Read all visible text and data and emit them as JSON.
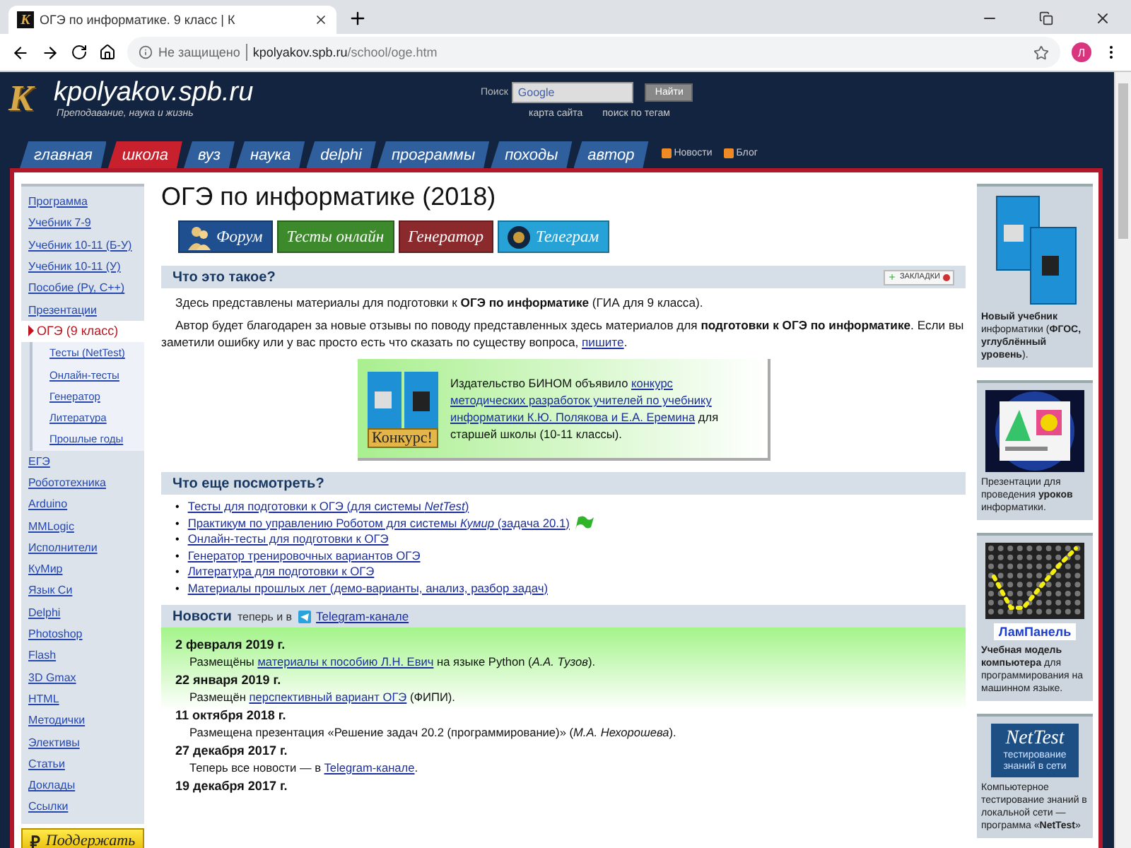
{
  "browser": {
    "favicon_letter": "K",
    "tab_title": "ОГЭ по информатике. 9 класс | К",
    "security": "Не защищено",
    "host": "kpolyakov.spb.ru",
    "path": "/school/oge.htm",
    "profile_initial": "Л"
  },
  "site": {
    "logo_letter": "K",
    "title": "kpolyakov.spb.ru",
    "slogan": "Преподавание, наука и жизнь",
    "search": {
      "label": "Поиск",
      "placeholder": "Google",
      "button": "Найти"
    },
    "links": [
      "карта сайта",
      "поиск по тегам"
    ],
    "nav_tabs": [
      {
        "label": "главная",
        "selected": false
      },
      {
        "label": "школа",
        "selected": true
      },
      {
        "label": "вуз",
        "selected": false
      },
      {
        "label": "наука",
        "selected": false
      },
      {
        "label": "delphi",
        "selected": false
      },
      {
        "label": "программы",
        "selected": false
      },
      {
        "label": "походы",
        "selected": false
      },
      {
        "label": "автор",
        "selected": false
      }
    ],
    "feeds": [
      "Новости",
      "Блог"
    ]
  },
  "sidebar": {
    "items": [
      {
        "label": "Программа",
        "selected": false
      },
      {
        "label": "Учебник 7-9",
        "selected": false
      },
      {
        "label": "Учебник 10-11 (Б-У)",
        "selected": false
      },
      {
        "label": "Учебник 10-11 (У)",
        "selected": false
      },
      {
        "label": "Пособие (Py, C++)",
        "selected": false
      },
      {
        "label": "Презентации",
        "selected": false
      },
      {
        "label": "ОГЭ (9 класс)",
        "selected": true,
        "children": [
          {
            "label": "Тесты (NetTest)",
            "selected": false
          },
          {
            "label": "Онлайн-тесты",
            "selected": false
          },
          {
            "label": "Генератор",
            "selected": false
          },
          {
            "label": "Литература",
            "selected": false
          },
          {
            "label": "Прошлые годы",
            "selected": false
          }
        ]
      },
      {
        "label": "ЕГЭ",
        "selected": false
      },
      {
        "label": "Робототехника",
        "selected": false
      },
      {
        "label": "Arduino",
        "selected": false
      },
      {
        "label": "MMLogic",
        "selected": false
      },
      {
        "label": "Исполнители",
        "selected": false
      },
      {
        "label": "КуМир",
        "selected": false
      },
      {
        "label": "Язык Си",
        "selected": false
      },
      {
        "label": "Delphi",
        "selected": false
      },
      {
        "label": "Photoshop",
        "selected": false
      },
      {
        "label": "Flash",
        "selected": false
      },
      {
        "label": "3D Gmax",
        "selected": false
      },
      {
        "label": "HTML",
        "selected": false
      },
      {
        "label": "Методички",
        "selected": false
      },
      {
        "label": "Элективы",
        "selected": false
      },
      {
        "label": "Статьи",
        "selected": false
      },
      {
        "label": "Доклады",
        "selected": false
      },
      {
        "label": "Ссылки",
        "selected": false
      }
    ],
    "donate": {
      "symbol": "₽",
      "label": "Поддержать"
    }
  },
  "main": {
    "title": "ОГЭ по информатике (2018)",
    "buttons": [
      {
        "label": "Форум",
        "kind": "people",
        "color": "#1f4f8e"
      },
      {
        "label": "Тесты онлайн",
        "kind": "plain",
        "color": "#3d8a2c"
      },
      {
        "label": "Генератор",
        "kind": "plain",
        "color": "#8a2a2c"
      },
      {
        "label": "Телеграм",
        "kind": "logo",
        "color": "#27a2d6"
      }
    ],
    "about": {
      "heading": "Что это такое?",
      "bookmarks": "ЗАКЛАДКИ",
      "paragraphs": [
        [
          {
            "kind": "text",
            "text": "Здесь представлены материалы для подготовки к **ОГЭ по информатике** (ГИА для 9 класса)."
          }
        ],
        [
          {
            "kind": "text",
            "text": "Автор будет благодарен за новые отзывы по поводу представленных здесь материалов для **подготовки к ОГЭ по информатике**. Если вы заметили ошибку или у вас просто есть что сказать по существу вопроса, "
          },
          {
            "kind": "link",
            "text": "пишите"
          },
          {
            "kind": "text",
            "text": "."
          }
        ]
      ],
      "promo": {
        "image_label": "Конкурс!",
        "lines": [
          [
            {
              "kind": "text",
              "text": "Издательство БИНОМ объявило "
            },
            {
              "kind": "link",
              "text": "конкурс"
            }
          ],
          [
            {
              "kind": "link",
              "text": "методических разработок учителей по учебнику"
            }
          ],
          [
            {
              "kind": "link",
              "text": "информатики К.Ю. Полякова и Е.А. Еремина"
            },
            {
              "kind": "text",
              "text": " для"
            }
          ],
          [
            {
              "kind": "text",
              "text": "старшей школы (10-11 классы)."
            }
          ]
        ]
      }
    },
    "more": {
      "heading": "Что еще посмотреть?",
      "bullet": "•",
      "items": [
        {
          "text": "Тесты для подготовки к ОГЭ (для системы *NetTest*)",
          "flagged": false
        },
        {
          "text": "Практикум по управлению Роботом для системы *Кумир* (задача 20.1)",
          "flagged": true
        },
        {
          "text": "Онлайн-тесты для подготовки к ОГЭ",
          "flagged": false
        },
        {
          "text": "Генератор тренировочных вариантов ОГЭ",
          "flagged": false
        },
        {
          "text": "Литература для подготовки к ОГЭ",
          "flagged": false
        },
        {
          "text": "Материалы прошлых лет (демо-варианты, анализ, разбор задач)",
          "flagged": false
        }
      ]
    },
    "news": {
      "heading": "Новости",
      "note": "теперь и в",
      "link": "Telegram-канале",
      "items": [
        {
          "date": "2 февраля 2019 г.",
          "parts": [
            {
              "kind": "text",
              "text": "Размещёны "
            },
            {
              "kind": "link",
              "text": "материалы к пособию Л.Н. Евич"
            },
            {
              "kind": "text",
              "text": " на языке Python (*А.А. Тузов*)."
            }
          ]
        },
        {
          "date": "22 января 2019 г.",
          "parts": [
            {
              "kind": "text",
              "text": "Размещён "
            },
            {
              "kind": "link",
              "text": "перспективный вариант ОГЭ"
            },
            {
              "kind": "text",
              "text": " (ФИПИ)."
            }
          ]
        },
        {
          "date": "11 октября 2018 г.",
          "parts": [
            {
              "kind": "text",
              "text": "Размещена презентация «Решение задач 20.2 (программирование)» (*М.А. Нехорошева*)."
            }
          ]
        },
        {
          "date": "27 декабря 2017 г.",
          "parts": [
            {
              "kind": "text",
              "text": "Теперь все новости — в "
            },
            {
              "kind": "link",
              "text": "Telegram-канале"
            },
            {
              "kind": "text",
              "text": "."
            }
          ]
        },
        {
          "date": "19 декабря 2017 г."
        }
      ]
    }
  },
  "aside": {
    "cards": [
      {
        "kind": "books",
        "caption": "**Новый учебник** информатики (**ФГОС, углублённый уровень**)."
      },
      {
        "kind": "picture",
        "caption": "Презентации для проведения **уроков** информатики."
      },
      {
        "kind": "lampanel",
        "logo": "ЛамПанель",
        "caption": "**Учебная модель компьютера** для программирования на машинном языке."
      },
      {
        "kind": "nettest",
        "logo": "NetTest",
        "logo_subtitle": "тестирование знаний в сети",
        "caption": "Компьютерное тестирование знаний в локальной сети — программа «**NetTest**»"
      }
    ]
  }
}
